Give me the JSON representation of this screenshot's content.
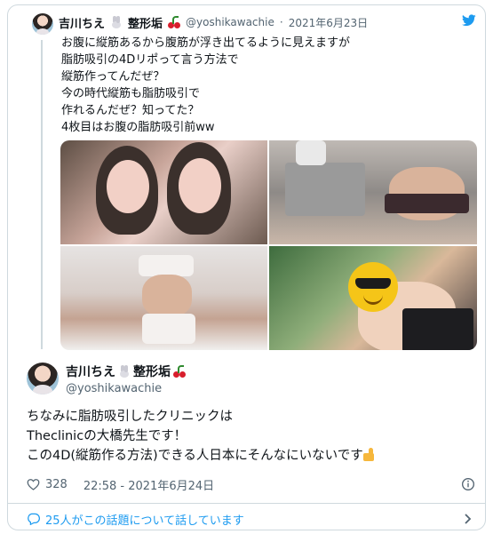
{
  "quoted": {
    "author_name": "吉川ちえ",
    "badge_text": "整形垢",
    "handle": "@yoshikawachie",
    "separator": "·",
    "date": "2021年6月23日",
    "lines": [
      "お腹に縦筋あるから腹筋が浮き出てるように見えますが",
      "脂肪吸引の4Dリポって言う方法で",
      "縦筋作ってんだぜ？",
      "今の時代縦筋も脂肪吸引で",
      "作れるんだぜ？知ってた？",
      "4枚目はお腹の脂肪吸引前ww"
    ]
  },
  "tweet": {
    "author_name": "吉川ちえ",
    "badge_text": "整形垢",
    "handle": "@yoshikawachie",
    "lines": [
      "ちなみに脂肪吸引したクリニックは",
      "Theclinicの大橋先生です！",
      "この4D(縦筋作る方法)できる人日本にそんなにいないです"
    ],
    "likes": "328",
    "timestamp": "22:58 - 2021年6月24日"
  },
  "footer": {
    "replies_text": "25人がこの話題について話しています"
  },
  "icons": {
    "brand": "twitter-bird-icon",
    "like": "heart-icon",
    "info": "info-icon",
    "reply": "speech-bubble-icon",
    "chevron": "chevron-right-icon"
  },
  "colors": {
    "accent": "#1d9bf0",
    "text": "#0f1419",
    "muted": "#536471",
    "border": "#cfd9de"
  }
}
